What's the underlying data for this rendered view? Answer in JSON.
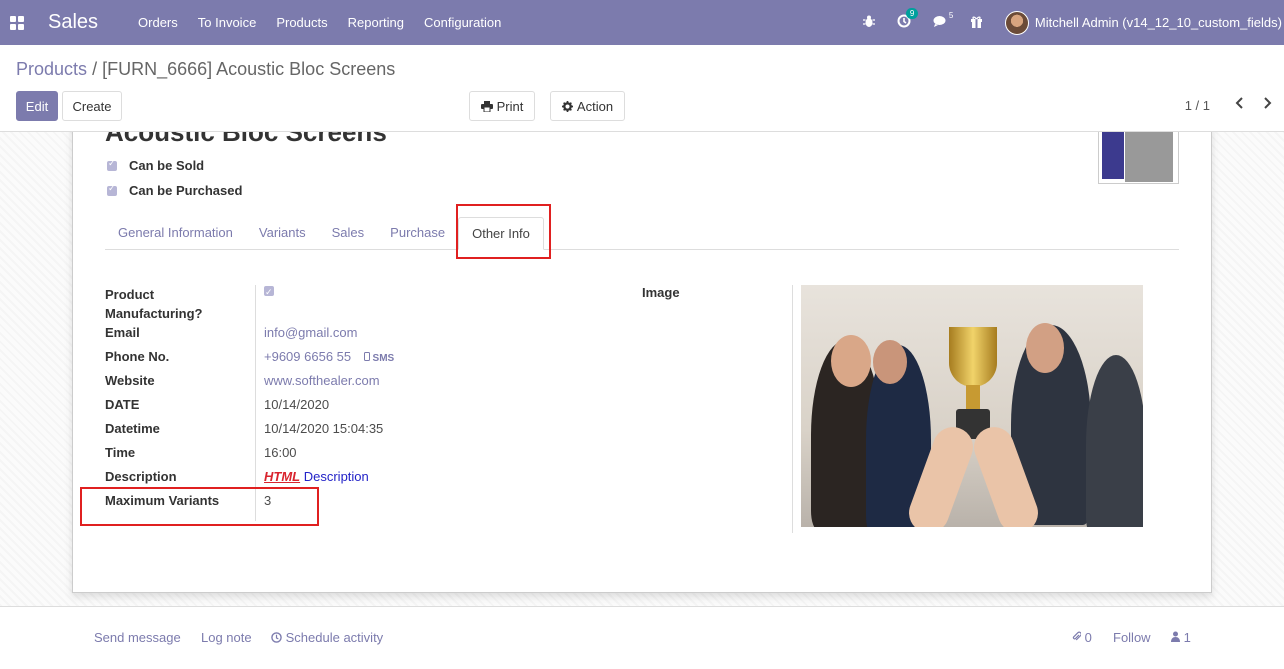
{
  "navbar": {
    "app_name": "Sales",
    "menu": [
      "Orders",
      "To Invoice",
      "Products",
      "Reporting",
      "Configuration"
    ],
    "activity_count": "9",
    "message_count": "5",
    "user": "Mitchell Admin (v14_12_10_custom_fields)"
  },
  "breadcrumb": {
    "parent": "Products",
    "separator": "/",
    "current": "[FURN_6666] Acoustic Bloc Screens"
  },
  "buttons": {
    "edit": "Edit",
    "create": "Create",
    "print": "Print",
    "action": "Action"
  },
  "pager": {
    "value": "1 / 1"
  },
  "product": {
    "title": "Acoustic Bloc Screens",
    "can_be_sold": "Can be Sold",
    "can_be_purchased": "Can be Purchased"
  },
  "tabs": [
    "General Information",
    "Variants",
    "Sales",
    "Purchase",
    "Other Info"
  ],
  "active_tab": "Other Info",
  "fields": {
    "manufacturing_label": "Product Manufacturing?",
    "email_label": "Email",
    "email_value": "info@gmail.com",
    "phone_label": "Phone No.",
    "phone_value": "+9609 6656 55",
    "sms_label": "SMS",
    "website_label": "Website",
    "website_value": "www.softhealer.com",
    "date_label": "DATE",
    "date_value": "10/14/2020",
    "datetime_label": "Datetime",
    "datetime_value": "10/14/2020 15:04:35",
    "time_label": "Time",
    "time_value": "16:00",
    "description_label": "Description",
    "description_html": "HTML",
    "description_text": "Description",
    "max_variants_label": "Maximum Variants",
    "max_variants_value": "3",
    "image_label": "Image"
  },
  "chatter": {
    "send_message": "Send message",
    "log_note": "Log note",
    "schedule_activity": "Schedule activity",
    "attachments": "0",
    "follow": "Follow",
    "followers": "1"
  },
  "colors": {
    "brand": "#7c7bad",
    "highlight_box": "#e02020",
    "badge": "#00a09d"
  }
}
